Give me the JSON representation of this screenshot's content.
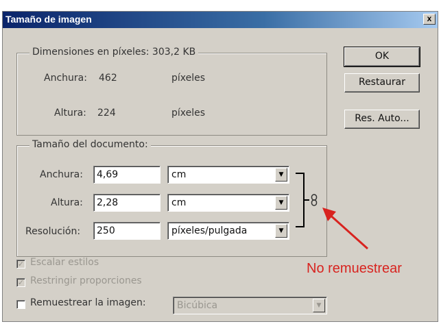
{
  "window": {
    "title": "Tamaño de imagen",
    "close_glyph": "x"
  },
  "pixel_dimensions": {
    "legend": "Dimensiones en píxeles: 303,2 KB",
    "width_label": "Anchura:",
    "width_value": "462",
    "width_unit": "píxeles",
    "height_label": "Altura:",
    "height_value": "224",
    "height_unit": "píxeles"
  },
  "buttons": {
    "ok": "OK",
    "reset": "Restaurar",
    "auto": "Res. Auto..."
  },
  "document_size": {
    "legend": "Tamaño del documento:",
    "width_label": "Anchura:",
    "width_value": "4,69",
    "width_unit": "cm",
    "height_label": "Altura:",
    "height_value": "2,28",
    "height_unit": "cm",
    "resolution_label": "Resolución:",
    "resolution_value": "250",
    "resolution_unit": "píxeles/pulgada"
  },
  "options": {
    "scale_styles": {
      "label": "Escalar estilos",
      "checked": true,
      "enabled": false
    },
    "constrain": {
      "label": "Restringir proporciones",
      "checked": true,
      "enabled": false
    },
    "resample": {
      "label": "Remuestrear la imagen:",
      "checked": false,
      "enabled": true
    },
    "resample_method": "Bicúbica"
  },
  "annotation": {
    "text": "No remuestrear",
    "color": "#d8231f"
  },
  "icons": {
    "link": "chain-link-icon",
    "dropdown": "chevron-down-icon",
    "close": "close-icon"
  }
}
